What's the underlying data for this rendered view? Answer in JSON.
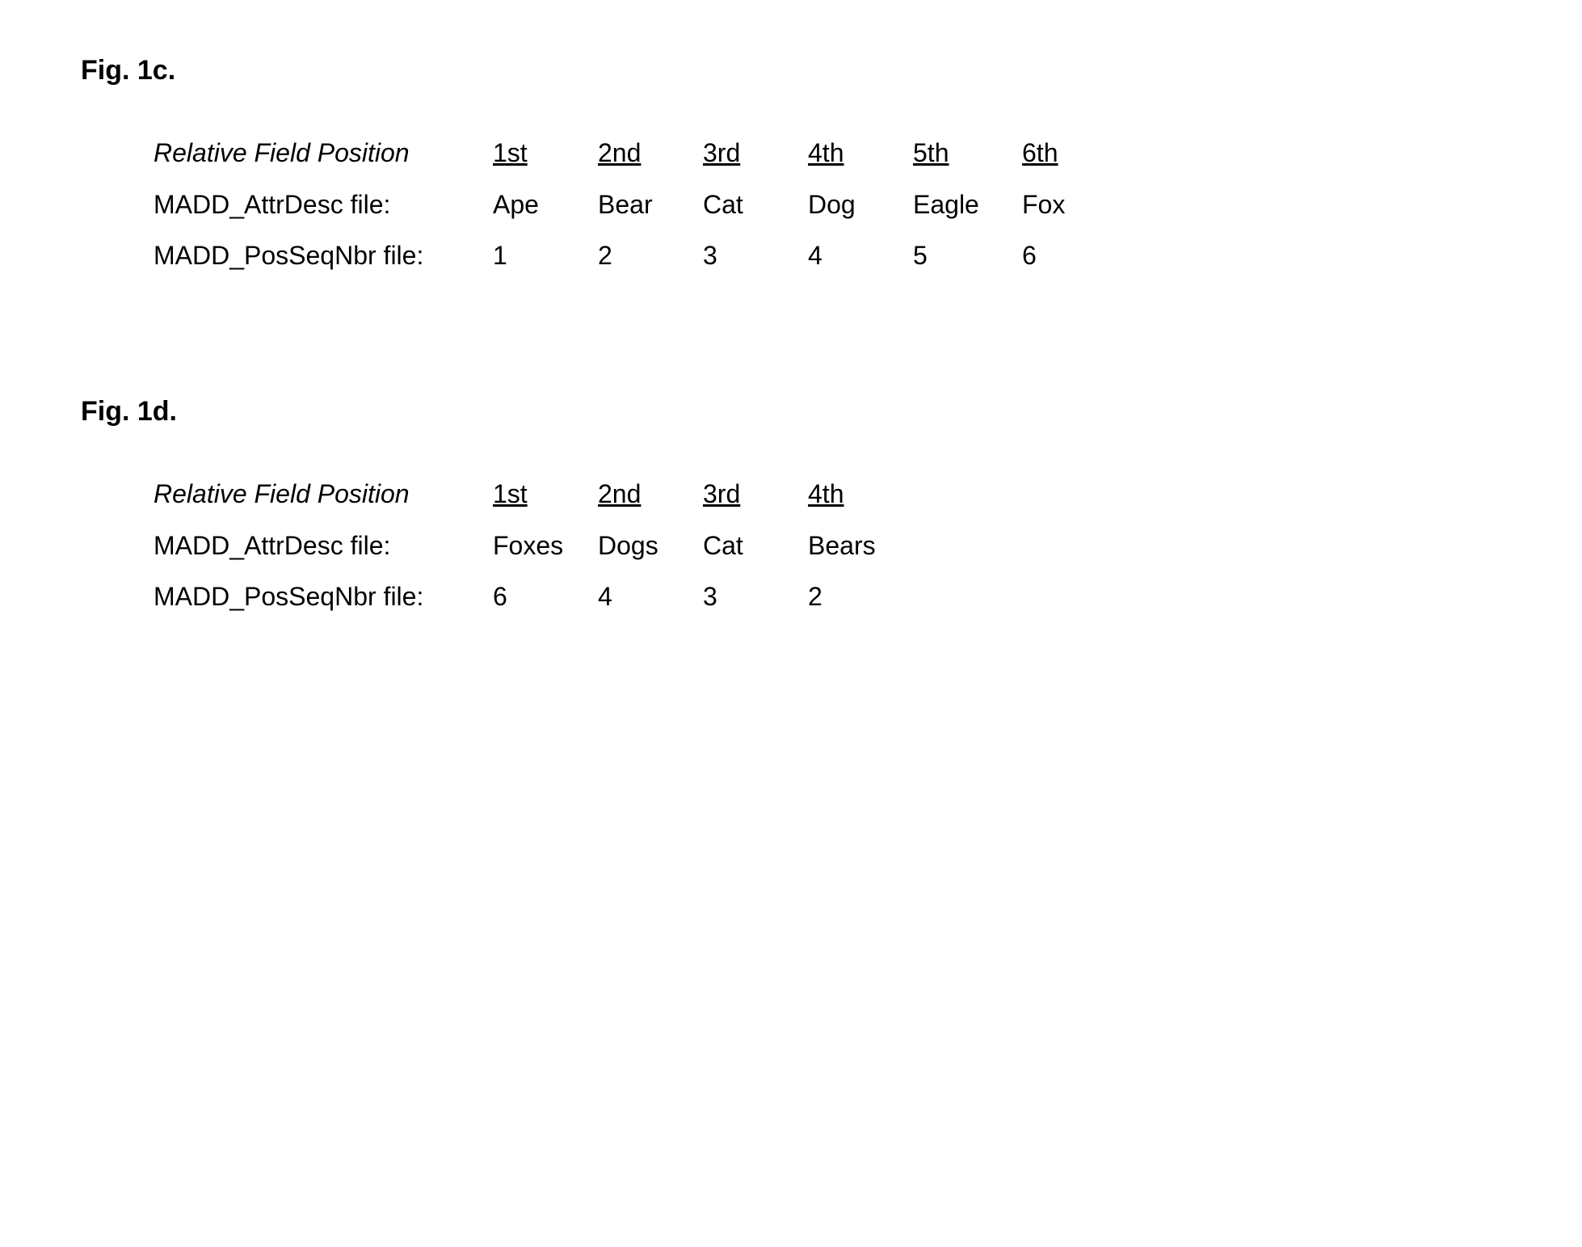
{
  "figures": [
    {
      "title": "Fig. 1c.",
      "headers_label": "Relative Field Position",
      "headers": [
        "1st",
        "2nd",
        "3rd",
        "4th",
        "5th",
        "6th"
      ],
      "rows": [
        {
          "label": "MADD_AttrDesc file:",
          "values": [
            "Ape",
            "Bear",
            "Cat",
            "Dog",
            "Eagle",
            "Fox"
          ]
        },
        {
          "label": "MADD_PosSeqNbr file:",
          "values": [
            "1",
            "2",
            "3",
            "4",
            "5",
            "6"
          ]
        }
      ]
    },
    {
      "title": "Fig. 1d.",
      "headers_label": "Relative Field Position",
      "headers": [
        "1st",
        "2nd",
        "3rd",
        "4th"
      ],
      "rows": [
        {
          "label": "MADD_AttrDesc file:",
          "values": [
            "Foxes",
            "Dogs",
            "Cat",
            "Bears"
          ]
        },
        {
          "label": "MADD_PosSeqNbr file:",
          "values": [
            "6",
            "4",
            "3",
            "2"
          ]
        }
      ]
    }
  ]
}
